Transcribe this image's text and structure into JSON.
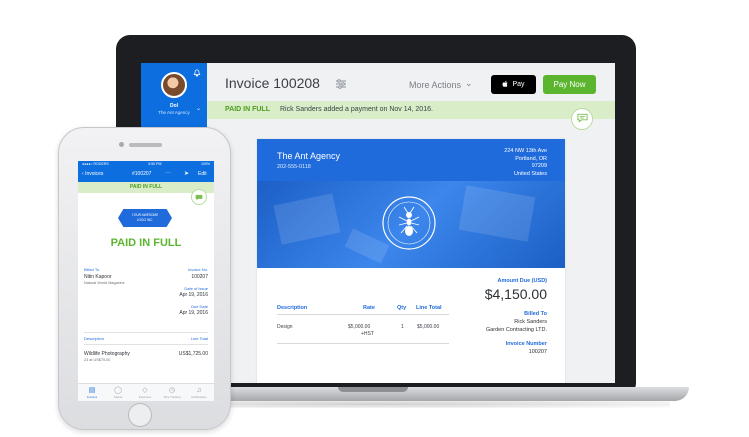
{
  "laptop": {
    "sidebar": {
      "user_name": "Dol",
      "user_company": "The Ant Agency"
    },
    "header": {
      "title": "Invoice 100208",
      "more_actions": "More Actions",
      "apple_pay_label": "Pay",
      "pay_now_label": "Pay Now"
    },
    "banner": {
      "status": "PAID IN FULL",
      "message": "Rick Sanders added a payment on Nov 14, 2016."
    },
    "invoice": {
      "company_name": "The Ant Agency",
      "company_phone": "202-555-0118",
      "address_line1": "224 NW 13th Ave",
      "address_line2": "Portland, OR",
      "address_line3": "97209",
      "address_line4": "United States",
      "amount_due_label": "Amount Due (USD)",
      "amount_due_value": "$4,150.00",
      "billed_to_label": "Billed To",
      "billed_to_name": "Rick Sanders",
      "billed_to_company": "Garden Contracting LTD.",
      "invoice_number_label": "Invoice Number",
      "invoice_number_value": "100207",
      "table": {
        "col_description": "Description",
        "col_rate": "Rate",
        "col_qty": "Qty",
        "col_line_total": "Line Total",
        "row_description": "Design",
        "row_rate": "$5,000.00",
        "row_tax": "+HST",
        "row_qty": "1",
        "row_line_total": "$5,000.00"
      }
    }
  },
  "phone": {
    "status_carrier": "●●●●○ ROGERS",
    "status_time": "5:50 PM",
    "status_battery": "100%",
    "nav_back": "Invoices",
    "nav_title": "#100207",
    "nav_edit": "Edit",
    "banner": "PAID IN FULL",
    "logo_text_1": "YOUR AWESOME",
    "logo_text_2": "LOGO INC.",
    "paid_title": "PAID IN FULL",
    "billed_to_label": "Billed To",
    "billed_to_name": "Nitin Kapoor",
    "billed_to_company": "Natural World Magazine",
    "invoice_no_label": "Invoice No.",
    "invoice_no_value": "100207",
    "date_of_issue_label": "Date of Issue",
    "date_of_issue_value": "Apr 19, 2016",
    "due_date_label": "Due Date",
    "due_date_value": "Apr 19, 2016",
    "col_description": "Description",
    "col_line_total": "Line Total",
    "item_name": "Wildlife Photography",
    "item_total": "US$1,725.00",
    "item_detail": "23 at US$75.00",
    "tabs": [
      {
        "label": "Invoices",
        "icon": "invoice-icon"
      },
      {
        "label": "Clients",
        "icon": "clients-icon"
      },
      {
        "label": "Expenses",
        "icon": "expenses-icon"
      },
      {
        "label": "Time Tracking",
        "icon": "clock-icon"
      },
      {
        "label": "Notifications",
        "icon": "bell-icon"
      }
    ]
  }
}
